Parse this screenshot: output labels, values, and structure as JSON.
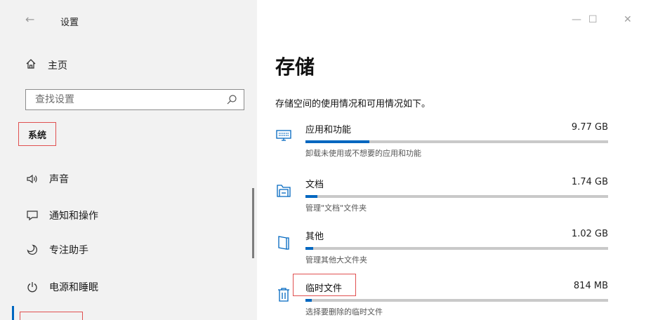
{
  "window": {
    "title": "设置",
    "back_glyph": "←",
    "minimize_glyph": "—",
    "maximize_glyph": "☐",
    "close_glyph": "✕"
  },
  "sidebar": {
    "home_label": "主页",
    "search_placeholder": "查找设置",
    "section_label": "系统",
    "items": [
      {
        "label": "声音",
        "icon": "speaker-icon"
      },
      {
        "label": "通知和操作",
        "icon": "notification-icon"
      },
      {
        "label": "专注助手",
        "icon": "moon-icon"
      },
      {
        "label": "电源和睡眠",
        "icon": "power-icon"
      }
    ]
  },
  "main": {
    "title": "存储",
    "description": "存储空间的使用情况和可用情况如下。",
    "categories": [
      {
        "name": "应用和功能",
        "size": "9.77 GB",
        "usage_fraction": 0.21,
        "subtitle": "卸载未使用或不想要的应用和功能",
        "icon": "apps-icon"
      },
      {
        "name": "文档",
        "size": "1.74 GB",
        "usage_fraction": 0.04,
        "subtitle": "管理\"文档\"文件夹",
        "icon": "folder-icon"
      },
      {
        "name": "其他",
        "size": "1.02 GB",
        "usage_fraction": 0.025,
        "subtitle": "管理其他大文件夹",
        "icon": "document-icon"
      },
      {
        "name": "临时文件",
        "size": "814 MB",
        "usage_fraction": 0.02,
        "subtitle": "选择要删除的临时文件",
        "icon": "trash-icon"
      }
    ]
  },
  "colors": {
    "accent": "#0067c0",
    "highlight": "#e05050"
  }
}
